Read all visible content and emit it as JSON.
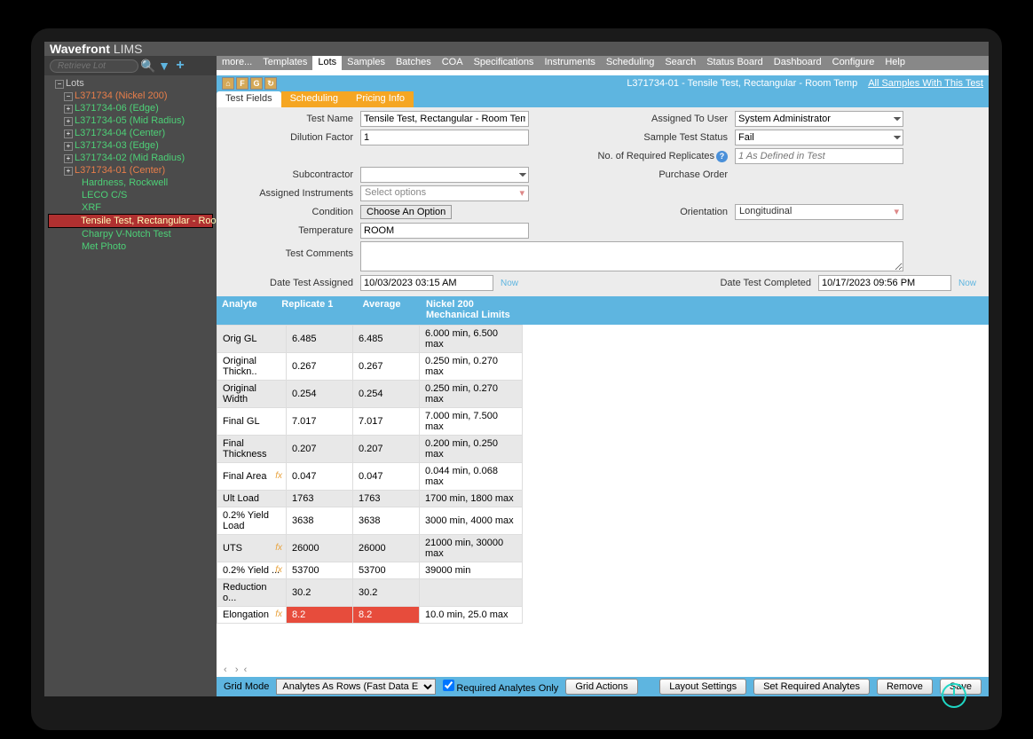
{
  "brand": {
    "name": "Wavefront",
    "suffix": "LIMS"
  },
  "retrieve_placeholder": "Retrieve Lot",
  "menu": [
    "more...",
    "Templates",
    "Lots",
    "Samples",
    "Batches",
    "COA",
    "Specifications",
    "Instruments",
    "Scheduling",
    "Search",
    "Status Board",
    "Dashboard",
    "Configure",
    "Help"
  ],
  "menu_active": "Lots",
  "sidebar": {
    "root": "Lots",
    "lot": "L371734 (Nickel 200)",
    "items": [
      {
        "label": "L371734-06 (Edge)",
        "cls": "green"
      },
      {
        "label": "L371734-05 (Mid Radius)",
        "cls": "green"
      },
      {
        "label": "L371734-04 (Center)",
        "cls": "green"
      },
      {
        "label": "L371734-03 (Edge)",
        "cls": "green"
      },
      {
        "label": "L371734-02 (Mid Radius)",
        "cls": "green"
      },
      {
        "label": "L371734-01 (Center)",
        "cls": "red"
      }
    ],
    "tests": [
      {
        "label": "Hardness, Rockwell",
        "cls": "green"
      },
      {
        "label": "LECO C/S",
        "cls": "green"
      },
      {
        "label": "XRF",
        "cls": "green"
      },
      {
        "label": "Tensile Test, Rectangular - Room Te",
        "cls": "highlight"
      },
      {
        "label": "Charpy V-Notch Test",
        "cls": "green"
      },
      {
        "label": "Met Photo",
        "cls": "green"
      }
    ]
  },
  "title_bar": {
    "breadcrumb": "L371734-01 - Tensile Test, Rectangular - Room Temp",
    "link": "All Samples With This Test",
    "icons": [
      "⌂",
      "F",
      "G",
      "↻"
    ]
  },
  "tabs": [
    {
      "label": "Test Fields",
      "style": "active"
    },
    {
      "label": "Scheduling",
      "style": "orange"
    },
    {
      "label": "Pricing Info",
      "style": "orange"
    }
  ],
  "form": {
    "test_name_label": "Test Name",
    "test_name": "Tensile Test, Rectangular - Room Temp",
    "dilution_label": "Dilution Factor",
    "dilution": "1",
    "subcontractor_label": "Subcontractor",
    "subcontractor": "",
    "assigned_instr_label": "Assigned Instruments",
    "assigned_instr": "Select options",
    "condition_label": "Condition",
    "condition_btn": "Choose An Option",
    "temperature_label": "Temperature",
    "temperature": "ROOM",
    "comments_label": "Test Comments",
    "date_assigned_label": "Date Test Assigned",
    "date_assigned": "10/03/2023 03:15 AM",
    "date_completed_label": "Date Test Completed",
    "date_completed": "10/17/2023 09:56 PM",
    "now": "Now",
    "assigned_user_label": "Assigned To User",
    "assigned_user": "System Administrator",
    "status_label": "Sample Test Status",
    "status": "Fail",
    "replicates_label": "No. of Required Replicates",
    "replicates": "1 As Defined in Test",
    "po_label": "Purchase Order",
    "orientation_label": "Orientation",
    "orientation": "Longitudinal"
  },
  "table": {
    "headers": [
      "Analyte",
      "Replicate 1",
      "Average",
      "Nickel 200 Mechanical Limits"
    ],
    "rows": [
      {
        "a": "Orig GL",
        "r": "6.485",
        "v": "6.485",
        "l": "6.000 min, 6.500 max"
      },
      {
        "a": "Original Thickn..",
        "r": "0.267",
        "v": "0.267",
        "l": "0.250 min, 0.270 max"
      },
      {
        "a": "Original Width",
        "r": "0.254",
        "v": "0.254",
        "l": "0.250 min, 0.270 max"
      },
      {
        "a": "Final GL",
        "r": "7.017",
        "v": "7.017",
        "l": "7.000 min, 7.500 max"
      },
      {
        "a": "Final Thickness",
        "r": "0.207",
        "v": "0.207",
        "l": "0.200 min, 0.250 max"
      },
      {
        "a": "Final Area",
        "fx": true,
        "r": "0.047",
        "v": "0.047",
        "l": "0.044 min, 0.068 max"
      },
      {
        "a": "Ult Load",
        "r": "1763",
        "v": "1763",
        "l": "1700 min, 1800 max"
      },
      {
        "a": "0.2% Yield Load",
        "r": "3638",
        "v": "3638",
        "l": "3000 min, 4000 max"
      },
      {
        "a": "UTS",
        "fx": true,
        "r": "26000",
        "v": "26000",
        "l": "21000 min, 30000 max"
      },
      {
        "a": "0.2% Yield ...",
        "fx": true,
        "r": "53700",
        "v": "53700",
        "l": "39000 min"
      },
      {
        "a": "Reduction o...",
        "r": "30.2",
        "v": "30.2",
        "l": ""
      },
      {
        "a": "Elongation",
        "fx": true,
        "r": "8.2",
        "v": "8.2",
        "l": "10.0 min, 25.0 max",
        "fail": true
      }
    ]
  },
  "footer": {
    "grid_mode_label": "Grid Mode",
    "grid_mode": "Analytes As Rows (Fast Data E",
    "required_only": "Required Analytes Only",
    "grid_actions": "Grid Actions",
    "layout_settings": "Layout Settings",
    "set_required": "Set Required Analytes",
    "remove": "Remove",
    "save": "Save"
  }
}
